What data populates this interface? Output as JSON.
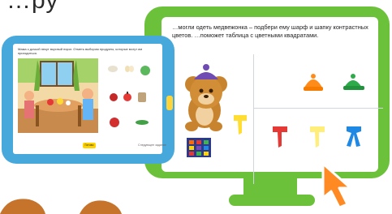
{
  "header_fragment": "…ру",
  "monitor": {
    "task_text": "…могли одеть медвежонка – подбери ему шарф и шапку контрастных цветов. …поможет таблица с цветными квадратами."
  },
  "tablet": {
    "task_text": "Мама с дочкой пекут вкусный пирог. Отметь выбором продукты, которые могут им пригодиться.",
    "done_label": "Готово",
    "next_label": "Следующее задание"
  },
  "colors": {
    "monitor_green": "#6cc13a",
    "tablet_blue": "#47a8dc",
    "cursor_orange": "#ff8a23"
  }
}
